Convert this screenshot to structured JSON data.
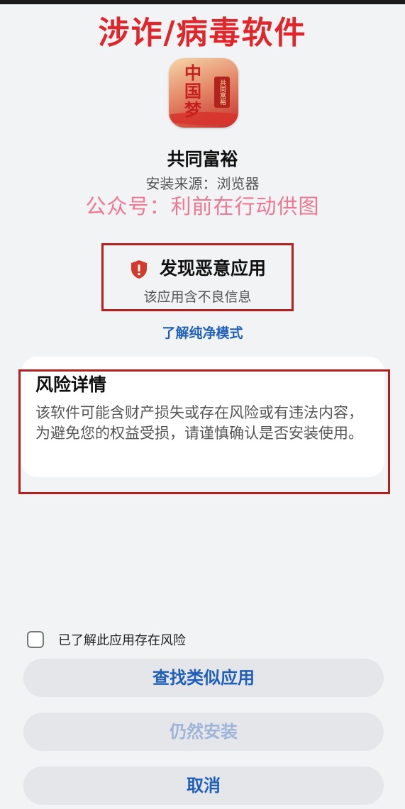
{
  "banner": "涉诈/病毒软件",
  "app": {
    "icon_text": "中国梦",
    "icon_seal_text": "共同富裕",
    "name": "共同富裕",
    "install_source": "安装来源：浏览器"
  },
  "watermark": "公众号：利前在行动供图",
  "warning": {
    "icon": "shield-alert-icon",
    "title": "发现恶意应用",
    "subtitle": "该应用含不良信息"
  },
  "learn_link": "了解纯净模式",
  "risk": {
    "title": "风险详情",
    "text": "该软件可能含财产损失或存在风险或有违法内容，为避免您的权益受损，请谨慎确认是否安装使用。"
  },
  "acknowledge": {
    "label": "已了解此应用存在风险",
    "checked": false
  },
  "buttons": {
    "find_similar": "查找类似应用",
    "install_anyway": "仍然安装",
    "cancel": "取消"
  },
  "colors": {
    "banner_red": "#e0262a",
    "highlight_border": "#b3201e",
    "link_blue": "#1f5fb8",
    "watermark_pink": "#f06a8a"
  }
}
